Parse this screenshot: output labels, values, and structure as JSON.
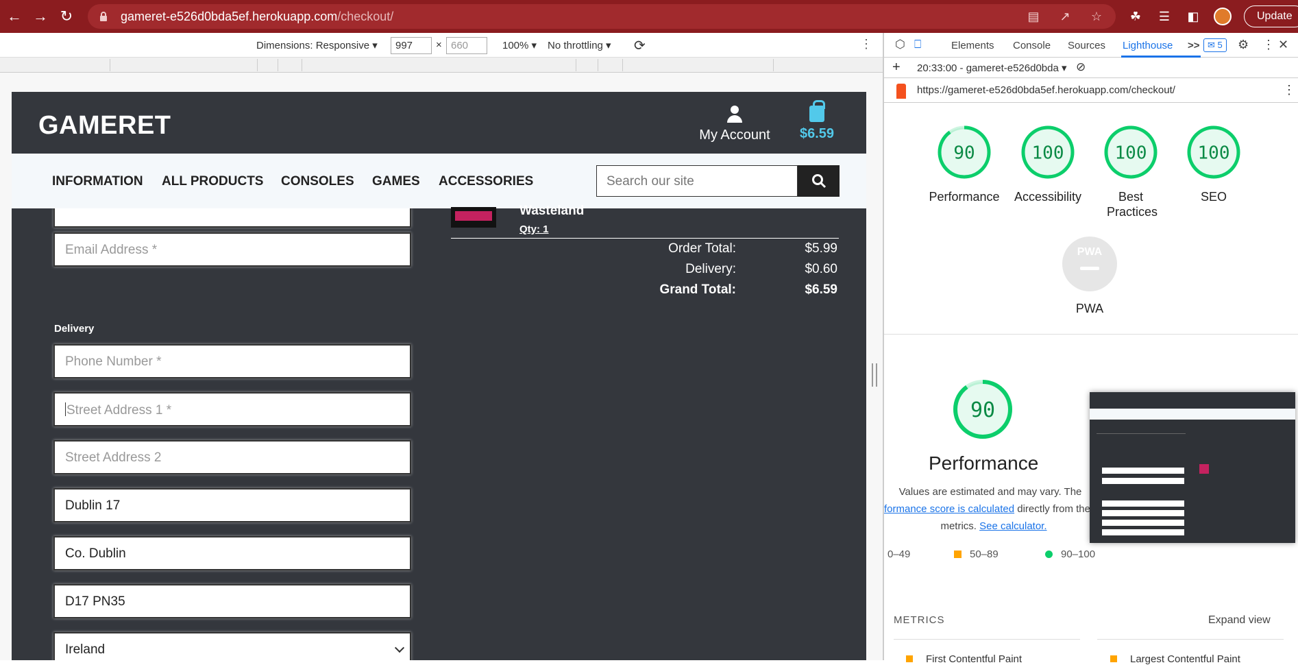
{
  "browser": {
    "url_host": "gameret-e526d0bda5ef.herokuapp.com",
    "url_path": "/checkout/",
    "update_label": "Update"
  },
  "device_toolbar": {
    "dimensions_label": "Dimensions: Responsive",
    "width": "997",
    "height": "660",
    "times": "×",
    "zoom": "100%",
    "throttling": "No throttling"
  },
  "site": {
    "logo": "GAMERET",
    "account_label": "My Account",
    "cart_total": "$6.59",
    "nav": [
      "INFORMATION",
      "ALL PRODUCTS",
      "CONSOLES",
      "GAMES",
      "ACCESSORIES"
    ],
    "search_placeholder": "Search our site"
  },
  "form": {
    "email_placeholder": "Email Address *",
    "delivery_label": "Delivery",
    "phone_placeholder": "Phone Number *",
    "street1_placeholder": "Street Address 1 *",
    "street2_placeholder": "Street Address 2",
    "town_value": "Dublin 17",
    "county_value": "Co. Dublin",
    "postcode_value": "D17 PN35",
    "country_value": "Ireland"
  },
  "order": {
    "product_name": "Wasteland",
    "qty": "Qty: 1",
    "order_total_label": "Order Total:",
    "order_total": "$5.99",
    "delivery_label": "Delivery:",
    "delivery": "$0.60",
    "grand_total_label": "Grand Total:",
    "grand_total": "$6.59"
  },
  "devtools": {
    "tabs": [
      "Elements",
      "Console",
      "Sources",
      "Lighthouse"
    ],
    "overflow": ">>",
    "badge": "5",
    "report_time": "20:33:00 - gameret-e526d0bda",
    "report_url": "https://gameret-e526d0bda5ef.herokuapp.com/checkout/",
    "scores": [
      {
        "label": "Performance",
        "value": 90
      },
      {
        "label": "Accessibility",
        "value": 100
      },
      {
        "label": "Best Practices",
        "value": 100
      },
      {
        "label": "SEO",
        "value": 100
      }
    ],
    "pwa_label": "PWA",
    "pwa_badge": "PWA",
    "big_score": 90,
    "perf_title": "Performance",
    "perf_desc_1": "Values are estimated and may vary. The",
    "perf_desc_link": "formance score is calculated",
    "perf_desc_2": " directly from thes",
    "perf_desc_3": "metrics. ",
    "calc_link": "See calculator.",
    "legend": [
      "0–49",
      "50–89",
      "90–100"
    ],
    "metrics_head": "METRICS",
    "expand_view": "Expand view",
    "metric_1": "First Contentful Paint",
    "metric_2": "Largest Contentful Paint"
  },
  "colors": {
    "chrome_bar": "#8b1c1f",
    "site_dark": "#34373d",
    "accent_cyan": "#52c9ea",
    "score_green": "#0cce6b",
    "score_orange": "#ffa400",
    "score_red": "#ff4e42"
  }
}
